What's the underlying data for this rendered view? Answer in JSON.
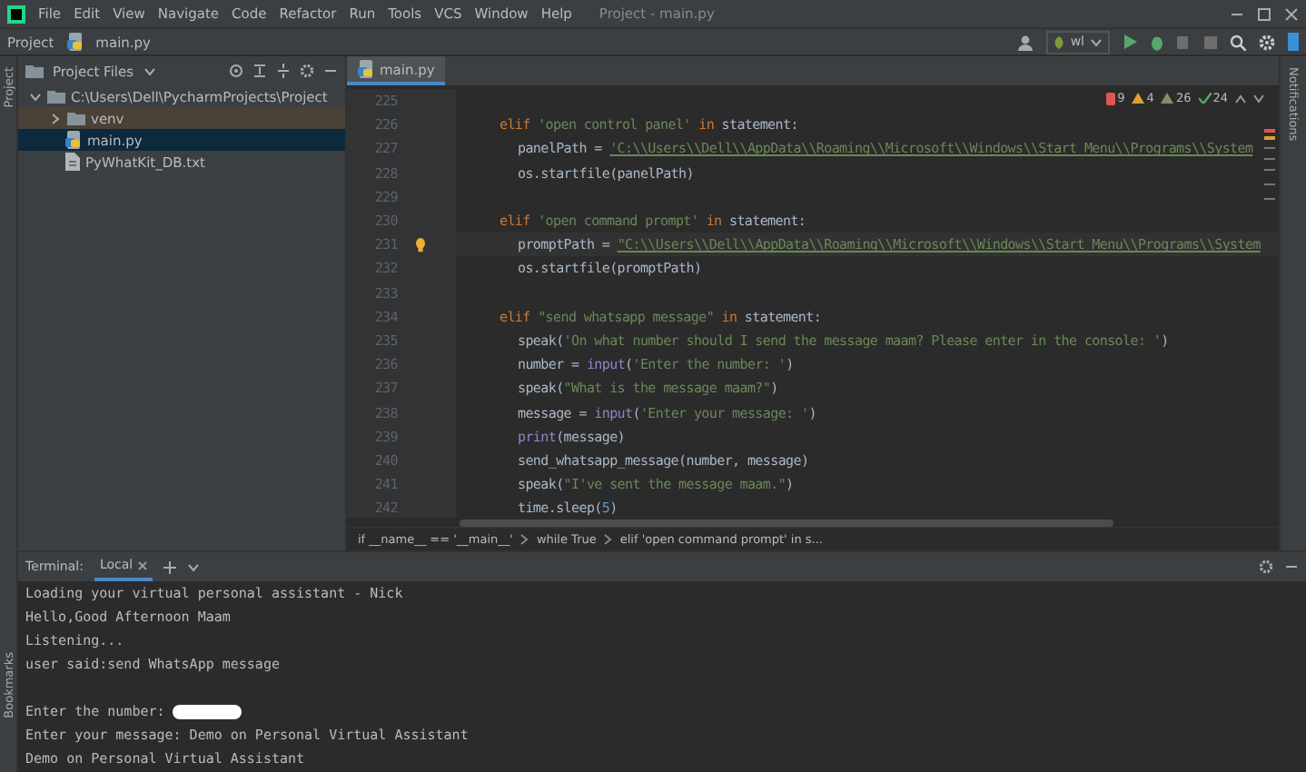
{
  "menu": [
    "File",
    "Edit",
    "View",
    "Navigate",
    "Code",
    "Refactor",
    "Run",
    "Tools",
    "VCS",
    "Window",
    "Help"
  ],
  "window": {
    "title": "Project - main.py"
  },
  "navbar": {
    "crumbs": [
      "Project",
      "main.py"
    ],
    "run_config": "wl"
  },
  "left_stripe": [
    "Project",
    "Bookmarks"
  ],
  "project_panel": {
    "title": "Project Files",
    "tree": [
      {
        "label": "C:\\Users\\Dell\\PycharmProjects\\Project",
        "kind": "folder",
        "expanded": true,
        "selected": false,
        "excluded": false,
        "children": [
          {
            "label": "venv",
            "kind": "folder",
            "expanded": false,
            "selected": false,
            "excluded": true
          },
          {
            "label": "main.py",
            "kind": "python",
            "selected": true,
            "excluded": false
          },
          {
            "label": "PyWhatKit_DB.txt",
            "kind": "text",
            "selected": false,
            "excluded": false
          }
        ]
      }
    ]
  },
  "editor": {
    "tabs": [
      {
        "label": "main.py",
        "selected": true
      }
    ],
    "inspections": [
      {
        "kind": "error",
        "count": "9"
      },
      {
        "kind": "warning",
        "count": "4"
      },
      {
        "kind": "weak",
        "count": "26"
      },
      {
        "kind": "typo",
        "count": "24"
      }
    ],
    "lines": [
      {
        "number": "225",
        "current": false
      },
      {
        "number": "226",
        "current": false,
        "tokens": [
          {
            "kind": "kw",
            "text": "elif "
          },
          {
            "kind": "str",
            "text": "'open control panel'"
          },
          {
            "kind": "kw",
            "text": " in "
          },
          {
            "kind": "plain",
            "text": "statement:"
          }
        ],
        "children": [
          {
            "number": "227",
            "current": false,
            "tokens": [
              {
                "kind": "plain",
                "text": "panelPath = "
              },
              {
                "kind": "path",
                "text": "'C:\\\\Users\\\\Dell\\\\AppData\\\\Roaming\\\\Microsoft\\\\Windows\\\\Start Menu\\\\Programs\\\\System"
              }
            ]
          },
          {
            "number": "228",
            "current": false,
            "tokens": [
              {
                "kind": "plain",
                "text": "os.startfile(panelPath)"
              }
            ]
          }
        ]
      },
      {
        "number": "229",
        "current": false
      },
      {
        "number": "230",
        "current": false,
        "tokens": [
          {
            "kind": "kw",
            "text": "elif "
          },
          {
            "kind": "str",
            "text": "'open command prompt'"
          },
          {
            "kind": "kw",
            "text": " in "
          },
          {
            "kind": "plain",
            "text": "statement:"
          }
        ],
        "children": [
          {
            "number": "231",
            "current": true,
            "tokens": [
              {
                "kind": "plain",
                "text": "promptPath = "
              },
              {
                "kind": "path",
                "text": "\"C:\\\\Users\\\\Dell\\\\AppData\\\\Roaming\\\\Microsoft\\\\Windows\\\\Start Menu\\\\Programs\\\\System"
              }
            ]
          },
          {
            "number": "232",
            "current": false,
            "tokens": [
              {
                "kind": "plain",
                "text": "os.startfile(promptPath)"
              }
            ]
          }
        ]
      },
      {
        "number": "233",
        "current": false
      },
      {
        "number": "234",
        "current": false,
        "tokens": [
          {
            "kind": "kw",
            "text": "elif "
          },
          {
            "kind": "str",
            "text": "\"send whatsapp message\""
          },
          {
            "kind": "kw",
            "text": " in "
          },
          {
            "kind": "plain",
            "text": "statement:"
          }
        ],
        "children": [
          {
            "number": "235",
            "current": false,
            "tokens": [
              {
                "kind": "plain",
                "text": "speak("
              },
              {
                "kind": "str",
                "text": "'On what number should I send the message maam? Please enter in the console: '"
              },
              {
                "kind": "plain",
                "text": ")"
              }
            ]
          },
          {
            "number": "236",
            "current": false,
            "tokens": [
              {
                "kind": "plain",
                "text": "number = "
              },
              {
                "kind": "fn",
                "text": "input"
              },
              {
                "kind": "plain",
                "text": "("
              },
              {
                "kind": "str",
                "text": "'Enter the number: '"
              },
              {
                "kind": "plain",
                "text": ")"
              }
            ]
          },
          {
            "number": "237",
            "current": false,
            "tokens": [
              {
                "kind": "plain",
                "text": "speak("
              },
              {
                "kind": "str",
                "text": "\"What is the message maam?\""
              },
              {
                "kind": "plain",
                "text": ")"
              }
            ]
          },
          {
            "number": "238",
            "current": false,
            "tokens": [
              {
                "kind": "plain",
                "text": "message = "
              },
              {
                "kind": "fn",
                "text": "input"
              },
              {
                "kind": "plain",
                "text": "("
              },
              {
                "kind": "str",
                "text": "'Enter your message: '"
              },
              {
                "kind": "plain",
                "text": ")"
              }
            ]
          },
          {
            "number": "239",
            "current": false,
            "tokens": [
              {
                "kind": "fn",
                "text": "print"
              },
              {
                "kind": "plain",
                "text": "(message)"
              }
            ]
          },
          {
            "number": "240",
            "current": false,
            "tokens": [
              {
                "kind": "plain",
                "text": "send_whatsapp_message(number, message)"
              }
            ]
          },
          {
            "number": "241",
            "current": false,
            "tokens": [
              {
                "kind": "plain",
                "text": "speak("
              },
              {
                "kind": "str",
                "text": "\"I've sent the message maam.\""
              },
              {
                "kind": "plain",
                "text": ")"
              }
            ]
          },
          {
            "number": "242",
            "current": false,
            "tokens": [
              {
                "kind": "plain",
                "text": "time.sleep("
              },
              {
                "kind": "num",
                "text": "5"
              },
              {
                "kind": "plain",
                "text": ")"
              }
            ]
          }
        ]
      }
    ],
    "breadcrumbs": [
      "if __name__ == '__main__'",
      "while True",
      "elif 'open command prompt' in s..."
    ]
  },
  "right_stripe": [
    "Notifications"
  ],
  "terminal": {
    "title": "Terminal:",
    "tabs": [
      {
        "label": "Local",
        "selected": true
      }
    ],
    "lines": [
      {
        "kind": "text",
        "text": "Loading your virtual personal assistant - Nick"
      },
      {
        "kind": "text",
        "text": "Hello,Good Afternoon Maam"
      },
      {
        "kind": "text",
        "text": "Listening..."
      },
      {
        "kind": "text",
        "text": "user said:send WhatsApp message"
      },
      {
        "kind": "blank"
      },
      {
        "kind": "redacted",
        "text": "Enter the number: "
      },
      {
        "kind": "text",
        "text": "Enter your message: Demo on Personal Virtual Assistant"
      },
      {
        "kind": "text",
        "text": "Demo on Personal Virtual Assistant"
      }
    ]
  }
}
